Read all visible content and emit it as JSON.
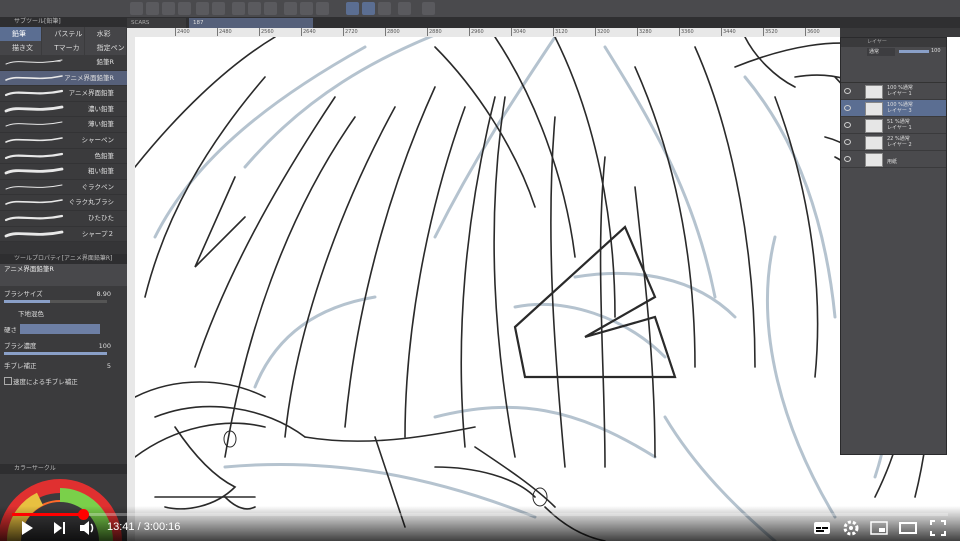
{
  "left_panel": {
    "sub_tool_header": "サブツール[鉛筆]",
    "category_tabs": [
      "鉛筆",
      "パステル",
      "水彩"
    ],
    "pen_tabs": [
      "描き文",
      "Tマーカー",
      "指定ペン"
    ],
    "brushes": [
      {
        "label": "鉛筆R",
        "selected": false
      },
      {
        "label": "アニメ界面鉛筆R",
        "selected": true
      },
      {
        "label": "アニメ界面鉛筆",
        "selected": false
      },
      {
        "label": "濃い鉛筆",
        "selected": false
      },
      {
        "label": "薄い鉛筆",
        "selected": false
      },
      {
        "label": "シャーペン",
        "selected": false
      },
      {
        "label": "色鉛筆",
        "selected": false
      },
      {
        "label": "粗い鉛筆",
        "selected": false
      },
      {
        "label": "ぐラクペン",
        "selected": false
      },
      {
        "label": "ぐラク丸ブラシ",
        "selected": false
      },
      {
        "label": "ひたひた",
        "selected": false
      },
      {
        "label": "シャープ２",
        "selected": false
      }
    ],
    "tool_property_header": "ツールプロパティ[アニメ界面鉛筆R]",
    "tool_name": "アニメ界面鉛筆R",
    "brush_size_label": "ブラシサイズ",
    "brush_size_value": "8.90",
    "brush_size_fraction": 0.45,
    "underlay_label": "下地混色",
    "hardness_label": "硬さ",
    "density_label": "ブラシ濃度",
    "density_value": "100",
    "density_fraction": 1.0,
    "stabilization_label": "手ブレ補正",
    "stabilization_value": "5",
    "speed_stabilization_label": "速度による手ブレ補正",
    "color_circle_header": "カラーサークル"
  },
  "canvas_tabs": [
    "SCARS",
    "187"
  ],
  "ruler_ticks": [
    "2400",
    "2480",
    "2560",
    "2640",
    "2720",
    "2800",
    "2880",
    "2960",
    "3040",
    "3120",
    "3200",
    "3280",
    "3360",
    "3440",
    "3520",
    "3600",
    "3680"
  ],
  "layer_panel": {
    "header": "レイヤー",
    "blend_mode": "通常",
    "opacity": "100",
    "layers": [
      {
        "opacity_mode": "100 %通常",
        "name": "レイヤー 1",
        "selected": false
      },
      {
        "opacity_mode": "100 %通常",
        "name": "レイヤー 3",
        "selected": true
      },
      {
        "opacity_mode": "51 %通常",
        "name": "レイヤー 1",
        "selected": false
      },
      {
        "opacity_mode": "22 %通常",
        "name": "レイヤー 2",
        "selected": false
      },
      {
        "opacity_mode": "",
        "name": "用紙",
        "selected": false
      }
    ]
  },
  "player": {
    "current_time": "13:41",
    "duration": "3:00:16",
    "time_text": "13:41 / 3:00:16",
    "progress_fraction": 0.076,
    "accent_color": "#ff0000",
    "controls": [
      "play-icon",
      "next-icon",
      "volume-icon",
      "subtitles-icon",
      "settings-icon",
      "miniplayer-icon",
      "theater-icon",
      "fullscreen-icon"
    ]
  }
}
